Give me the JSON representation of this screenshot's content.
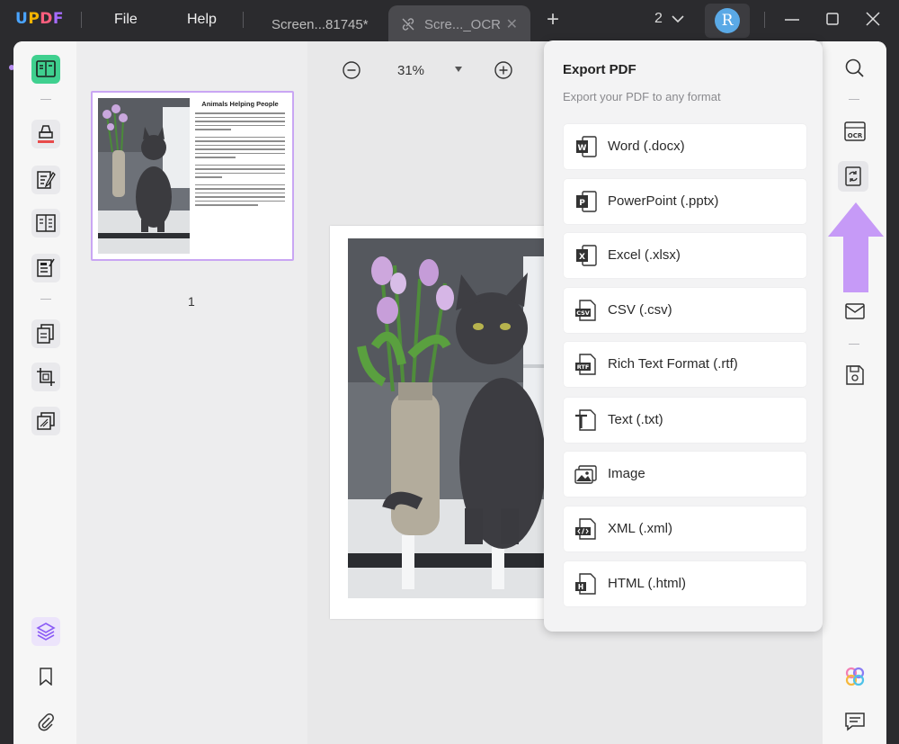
{
  "app": {
    "logo": [
      "U",
      "P",
      "D",
      "F"
    ]
  },
  "menu": {
    "file": "File",
    "help": "Help"
  },
  "tabs": [
    {
      "label": "Screen...81745*"
    },
    {
      "label": "Scre..._OCR"
    }
  ],
  "titlebar": {
    "window_count": "2",
    "avatar_initial": "R"
  },
  "thumbnail": {
    "title": "Animals Helping People",
    "page_number": "1"
  },
  "zoom": {
    "value": "31%"
  },
  "export": {
    "title": "Export PDF",
    "subtitle": "Export your PDF to any format",
    "formats": [
      {
        "label": "Word (.docx)",
        "icon": "word-icon"
      },
      {
        "label": "PowerPoint (.pptx)",
        "icon": "powerpoint-icon"
      },
      {
        "label": "Excel (.xlsx)",
        "icon": "excel-icon"
      },
      {
        "label": "CSV (.csv)",
        "icon": "csv-icon"
      },
      {
        "label": "Rich Text Format (.rtf)",
        "icon": "rtf-icon"
      },
      {
        "label": "Text (.txt)",
        "icon": "txt-icon"
      },
      {
        "label": "Image",
        "icon": "image-icon"
      },
      {
        "label": "XML (.xml)",
        "icon": "xml-icon"
      },
      {
        "label": "HTML (.html)",
        "icon": "html-icon"
      }
    ]
  },
  "colors": {
    "accent": "#3fd08f",
    "highlight_arrow": "#c69af7",
    "thumb_border": "#c9a6f3"
  }
}
